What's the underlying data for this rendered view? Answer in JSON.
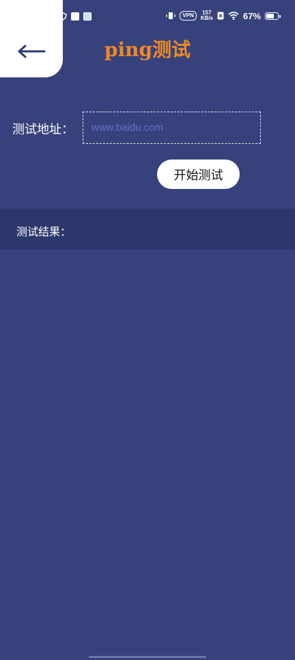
{
  "status_bar": {
    "network_speed": "157",
    "network_speed_unit": "KB/s",
    "vpn_label": "VPN",
    "battery_text": "67%",
    "battery_level": 0.67,
    "left_icons": [
      "app-icon-cc",
      "shield-icon",
      "mail-icon",
      "gallery-icon"
    ]
  },
  "header": {
    "title": "ping测试",
    "title_color": "#f08a24",
    "back_icon": "arrow-left-icon"
  },
  "form": {
    "address_label": "测试地址：",
    "address_value": "",
    "address_placeholder": "www.baidu.com",
    "start_button_label": "开始测试"
  },
  "results": {
    "label": "测试结果："
  },
  "colors": {
    "background": "#37427c",
    "results_bar": "#2c386c",
    "accent": "#f08a24"
  }
}
